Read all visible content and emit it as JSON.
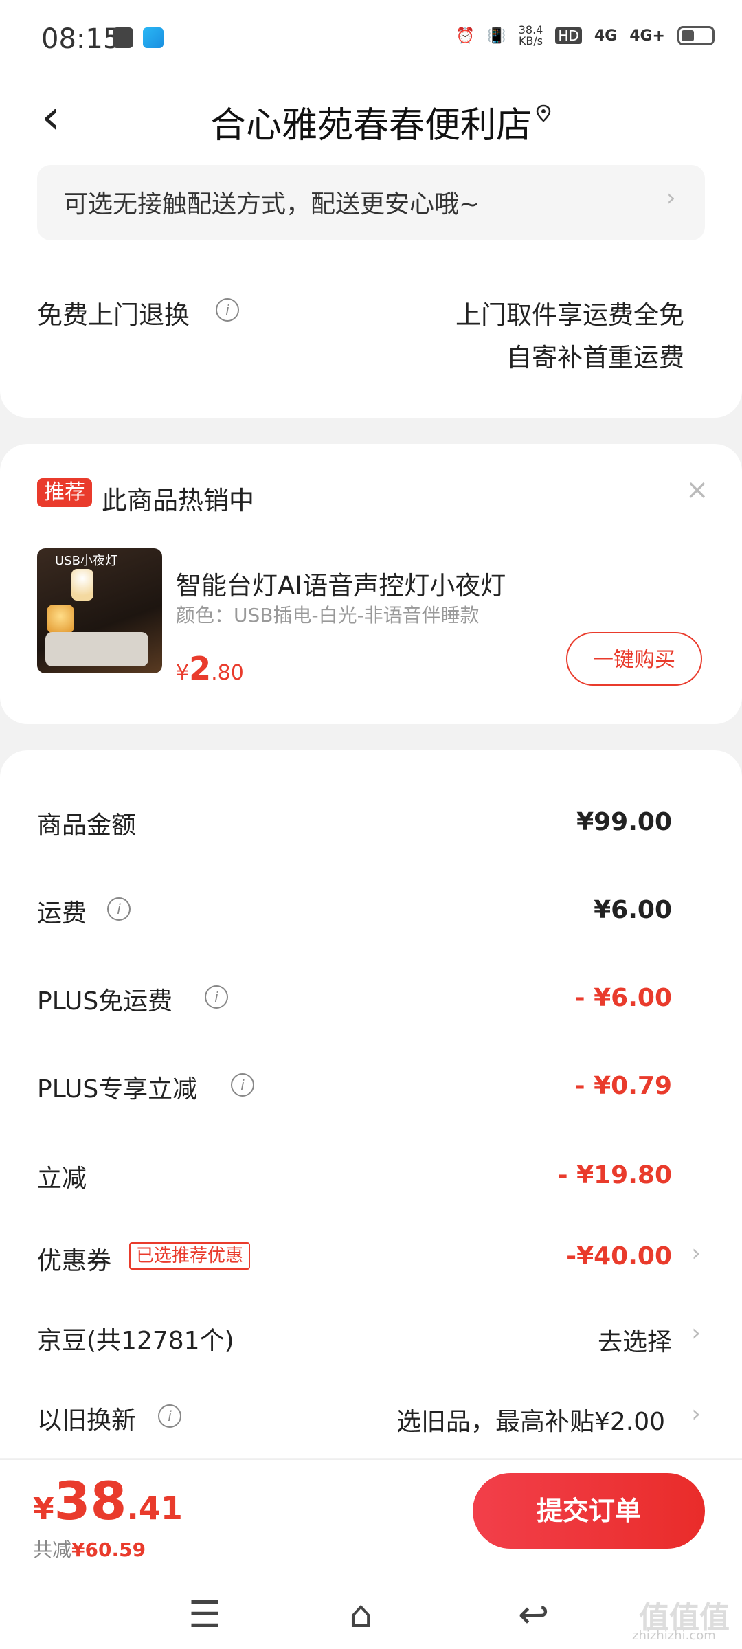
{
  "status_bar": {
    "time": "08:15",
    "net_speed": "38.4\nKB/s",
    "net_speed_top": "38.4",
    "net_speed_bottom": "KB/s",
    "hd": "HD",
    "sim1": "4G",
    "sim2": "4G+"
  },
  "header": {
    "back_icon": "chevron-left-icon",
    "title": "合心雅苑春春便利店",
    "pin_icon": "location-pin-icon"
  },
  "delivery_notice": "可选无接触配送方式，配送更安心哦~",
  "return_service": {
    "label": "免费上门退换",
    "line1": "上门取件享运费全免",
    "line2": "自寄补首重运费"
  },
  "recommend": {
    "tag": "推荐",
    "heading": "此商品热销中",
    "product_image_text": "USB小夜灯",
    "product_name": "智能台灯AI语音声控灯小夜灯",
    "product_spec": "颜色：USB插电-白光-非语音伴睡款",
    "price_symbol": "¥",
    "price_int": "2",
    "price_dec": ".80",
    "buy_button": "一键购买"
  },
  "summary": {
    "rows": [
      {
        "label": "商品金额",
        "value": "¥99.00"
      },
      {
        "label": "运费",
        "value": "¥6.00"
      },
      {
        "label": "PLUS免运费",
        "value": "- ¥6.00"
      },
      {
        "label": "PLUS专享立减",
        "value": "- ¥0.79"
      },
      {
        "label": "立减",
        "value": "- ¥19.80"
      },
      {
        "label": "优惠券",
        "value": "-¥40.00",
        "tag": "已选推荐优惠"
      },
      {
        "label": "京豆(共12781个)",
        "value": "去选择"
      },
      {
        "label": "以旧换新",
        "value": "选旧品，最高补贴¥2.00"
      }
    ]
  },
  "footer": {
    "total_symbol": "¥",
    "total_int": "38",
    "total_dec": ".41",
    "saved_label": "共减",
    "saved_value": "¥60.59",
    "submit_button": "提交订单"
  },
  "nav": {
    "menu_icon": "menu-icon",
    "home_icon": "home-icon",
    "back_icon": "back-icon"
  },
  "watermark": {
    "main": "值值值",
    "site": "zhizhizhi.com"
  },
  "colors": {
    "accent": "#e93b2c",
    "background": "#f2f2f2"
  }
}
